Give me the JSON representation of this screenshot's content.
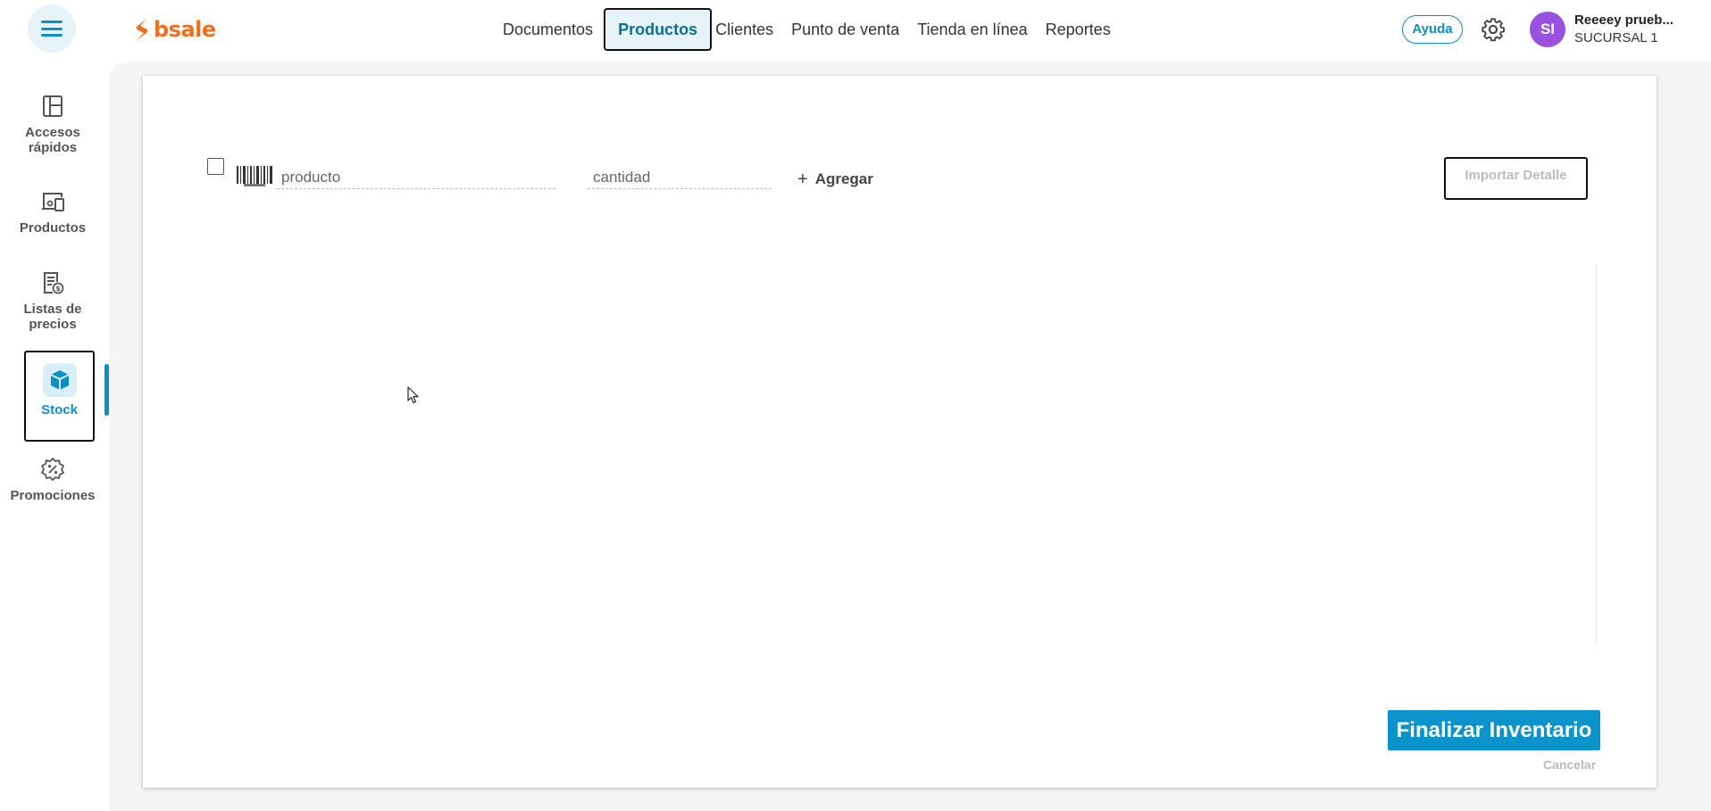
{
  "header": {
    "logo_text": "bsale",
    "nav": [
      {
        "label": "Documentos"
      },
      {
        "label": "Productos"
      },
      {
        "label": "Clientes"
      },
      {
        "label": "Punto de venta"
      },
      {
        "label": "Tienda en línea"
      },
      {
        "label": "Reportes"
      }
    ],
    "active_nav": "Productos",
    "help_label": "Ayuda",
    "avatar_initials": "SI",
    "user_name": "Reeeey prueb...",
    "branch": "SUCURSAL 1"
  },
  "sidebar": {
    "items": [
      {
        "label_line1": "Accesos",
        "label_line2": "rápidos",
        "icon": "dashboard-icon"
      },
      {
        "label_line1": "Productos",
        "label_line2": "",
        "icon": "products-icon"
      },
      {
        "label_line1": "Listas de",
        "label_line2": "precios",
        "icon": "price-list-icon"
      },
      {
        "label_line1": "Stock",
        "label_line2": "",
        "icon": "box-icon"
      },
      {
        "label_line1": "Promociones",
        "label_line2": "",
        "icon": "promo-icon"
      }
    ],
    "active": "Stock"
  },
  "form": {
    "product_placeholder": "producto",
    "quantity_placeholder": "cantidad",
    "add_label": "Agregar",
    "import_label": "Importar Detalle"
  },
  "footer": {
    "finish_label": "Finalizar Inventario",
    "cancel_label": "Cancelar"
  },
  "colors": {
    "accent": "#0b94cc",
    "brand": "#f26f21",
    "avatar": "#9b51e0"
  }
}
